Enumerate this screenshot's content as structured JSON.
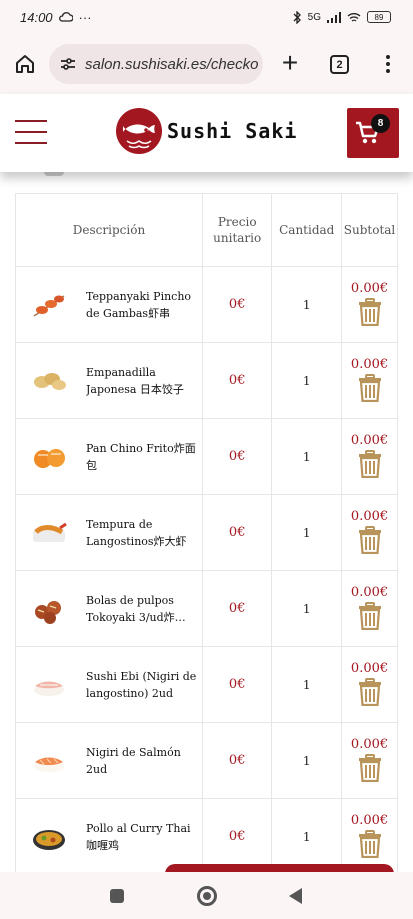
{
  "status_bar": {
    "time": "14:00",
    "more": "···",
    "network": "5G",
    "battery": "89"
  },
  "browser": {
    "url": "salon.sushisaki.es/checko",
    "tab_count": "2"
  },
  "header": {
    "brand": "Sushi Saki",
    "cart_count": "8"
  },
  "table": {
    "headers": {
      "description": "Descripción",
      "price_line1": "Precio",
      "price_line2": "unitario",
      "quantity": "Cantidad",
      "subtotal": "Subtotal"
    },
    "rows": [
      {
        "name": "Teppanyaki Pincho de Gambas虾串",
        "price": "0€",
        "qty": "1",
        "subtotal": "0.00€",
        "image": "skewer-icon"
      },
      {
        "name": "Empanadilla Japonesa 日本饺子",
        "price": "0€",
        "qty": "1",
        "subtotal": "0.00€",
        "image": "gyoza-icon"
      },
      {
        "name": "Pan Chino Frito炸面包",
        "price": "0€",
        "qty": "1",
        "subtotal": "0.00€",
        "image": "fried-bun-icon"
      },
      {
        "name": "Tempura de Langostinos炸大虾",
        "price": "0€",
        "qty": "1",
        "subtotal": "0.00€",
        "image": "tempura-icon"
      },
      {
        "name": "Bolas de pulpos Tokoyaki 3/ud炸…",
        "price": "0€",
        "qty": "1",
        "subtotal": "0.00€",
        "image": "takoyaki-icon"
      },
      {
        "name": "Sushi Ebi (Nigiri de langostino) 2ud",
        "price": "0€",
        "qty": "1",
        "subtotal": "0.00€",
        "image": "nigiri-ebi-icon"
      },
      {
        "name": "Nigiri de Salmón 2ud",
        "price": "0€",
        "qty": "1",
        "subtotal": "0.00€",
        "image": "nigiri-salmon-icon"
      },
      {
        "name": "Pollo al Curry Thai 咖喱鸡",
        "price": "0€",
        "qty": "1",
        "subtotal": "0.00€",
        "image": "curry-icon"
      }
    ]
  },
  "colors": {
    "brand_red": "#a31820",
    "trash_gold": "#b8935a",
    "browser_bg": "#fbf5f6"
  }
}
